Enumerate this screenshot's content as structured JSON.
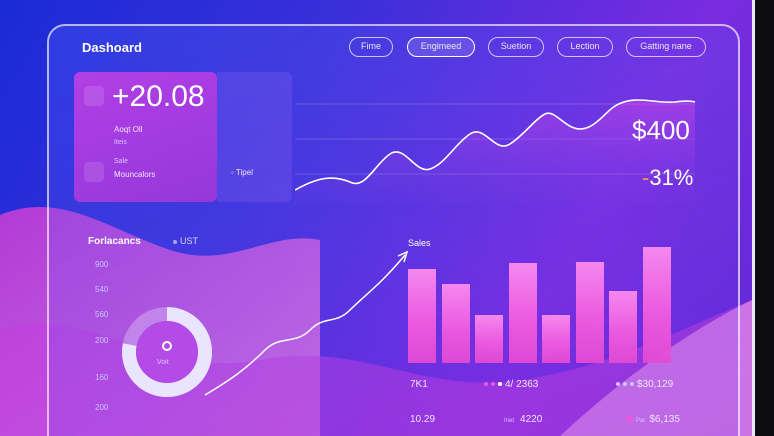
{
  "header": {
    "title": "Dashoard",
    "nav": [
      "Fime",
      "Engimeed",
      "Suetion",
      "Lection",
      "Gatting nane"
    ],
    "active_index": 1
  },
  "kpi_card": {
    "value": "+20.08",
    "line1": "Aoqt Oll",
    "line2": "Iteis",
    "line3": "Sale",
    "line4": "Mouncalors",
    "side_label": "Tipel"
  },
  "top_chart": {
    "price": "$400",
    "change_prefix": "-",
    "change": "31%"
  },
  "section": {
    "label": "Forlacancs",
    "tag": "UST",
    "sales_label": "Sales",
    "axis_ticks": [
      "900",
      "540",
      "560",
      "200",
      "160",
      "200"
    ]
  },
  "donut": {
    "label": "Voit",
    "fill_fraction": 0.78
  },
  "bars": {
    "heights_fraction": [
      0.78,
      0.66,
      0.4,
      0.83,
      0.4,
      0.84,
      0.6,
      0.97
    ]
  },
  "footer": {
    "left1": "7K1",
    "mid1": "4/ 2363",
    "right1": "$30,129",
    "left2": "10.29",
    "mid2_small": "Inet",
    "mid2": "4220",
    "right2_small": "Par",
    "right2": "$6,135"
  },
  "colors": {
    "accent_pink": "#e44ad4",
    "card_purple": "#a33ee0",
    "orange_dash": "#ff9a3c"
  }
}
